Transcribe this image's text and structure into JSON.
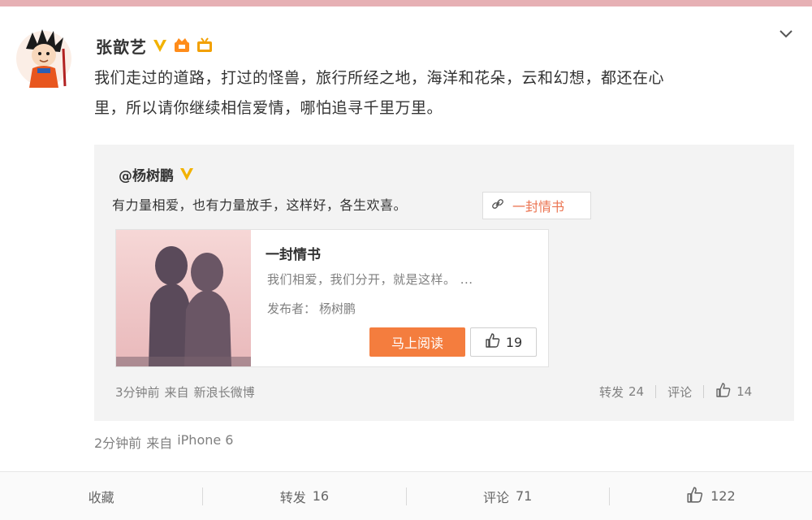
{
  "colors": {
    "accent_orange": "#f47d3e",
    "link_orange": "#eb7350",
    "verified_gold": "#f2b200",
    "repost_bg": "#f3f3f3"
  },
  "post": {
    "author": "张歆艺",
    "text_line1": "我们走过的道路，打过的怪兽，旅行所经之地，海洋和花朵，云和幻想，都还在心",
    "text_line2": "里，所以请你继续相信爱情，哪怕追寻千里万里。",
    "time": "2分钟前",
    "source_prefix": "来自",
    "source": "iPhone 6"
  },
  "repost": {
    "author": "@杨树鹏",
    "text": "有力量相爱，也有力量放手，这样好，各生欢喜。",
    "topic_tag": "一封情书",
    "article": {
      "title": "一封情书",
      "summary": "我们相爱，我们分开，就是这样。 ...",
      "publisher_label": "发布者：",
      "publisher": "杨树鹏",
      "read_button": "马上阅读",
      "likes": "19"
    },
    "time": "3分钟前",
    "source_prefix": "来自",
    "source": "新浪长微博",
    "forward_label": "转发",
    "forward_count": "24",
    "comment_label": "评论",
    "like_count": "14"
  },
  "actions": {
    "favorite": "收藏",
    "forward_label": "转发",
    "forward_count": "16",
    "comment_label": "评论",
    "comment_count": "71",
    "like_count": "122"
  },
  "icons": {
    "verified": "verified-v-icon",
    "member": "member-crown-icon",
    "tv": "tv-icon",
    "chevron": "chevron-down-icon",
    "link": "link-icon",
    "thumbs_up": "thumbs-up-icon"
  }
}
